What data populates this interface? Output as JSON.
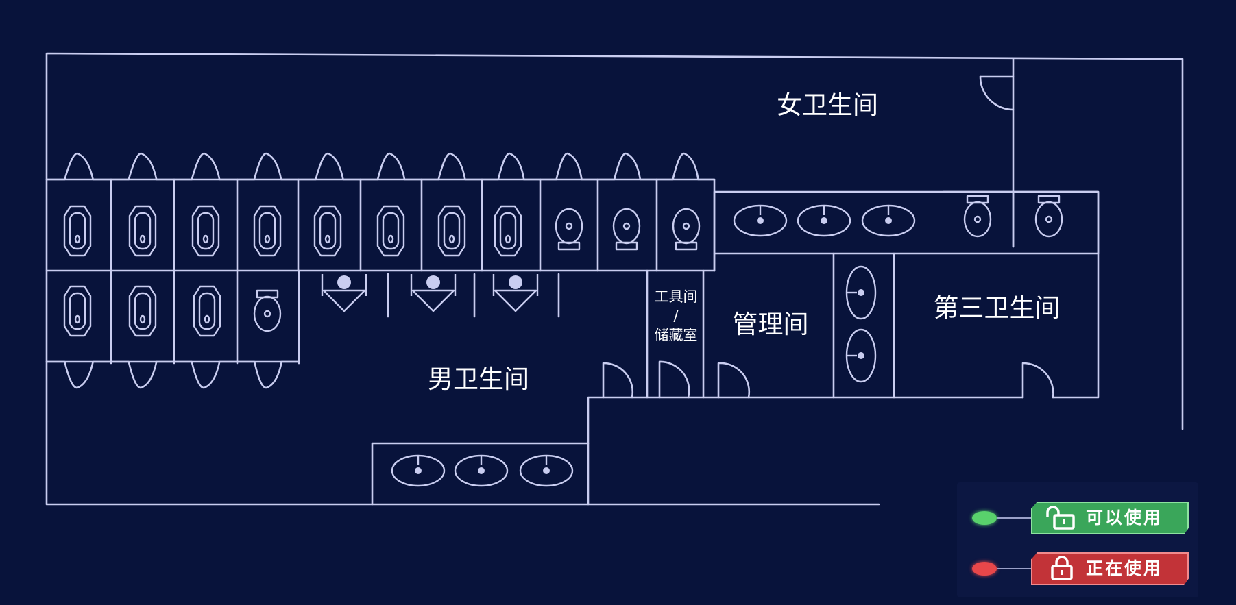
{
  "rooms": {
    "women": "女卫生间",
    "men": "男卫生间",
    "management": "管理间",
    "third": "第三卫生间",
    "tools_line1": "工具间",
    "tools_line2": "/",
    "tools_line3": "储藏室"
  },
  "legend": {
    "available": {
      "label": "可以使用",
      "color": "#59d16c",
      "icon": "unlock-icon"
    },
    "occupied": {
      "label": "正在使用",
      "color": "#e8474a",
      "icon": "lock-icon"
    }
  },
  "colors": {
    "background": "#08133b",
    "line": "#c9cdf0"
  }
}
